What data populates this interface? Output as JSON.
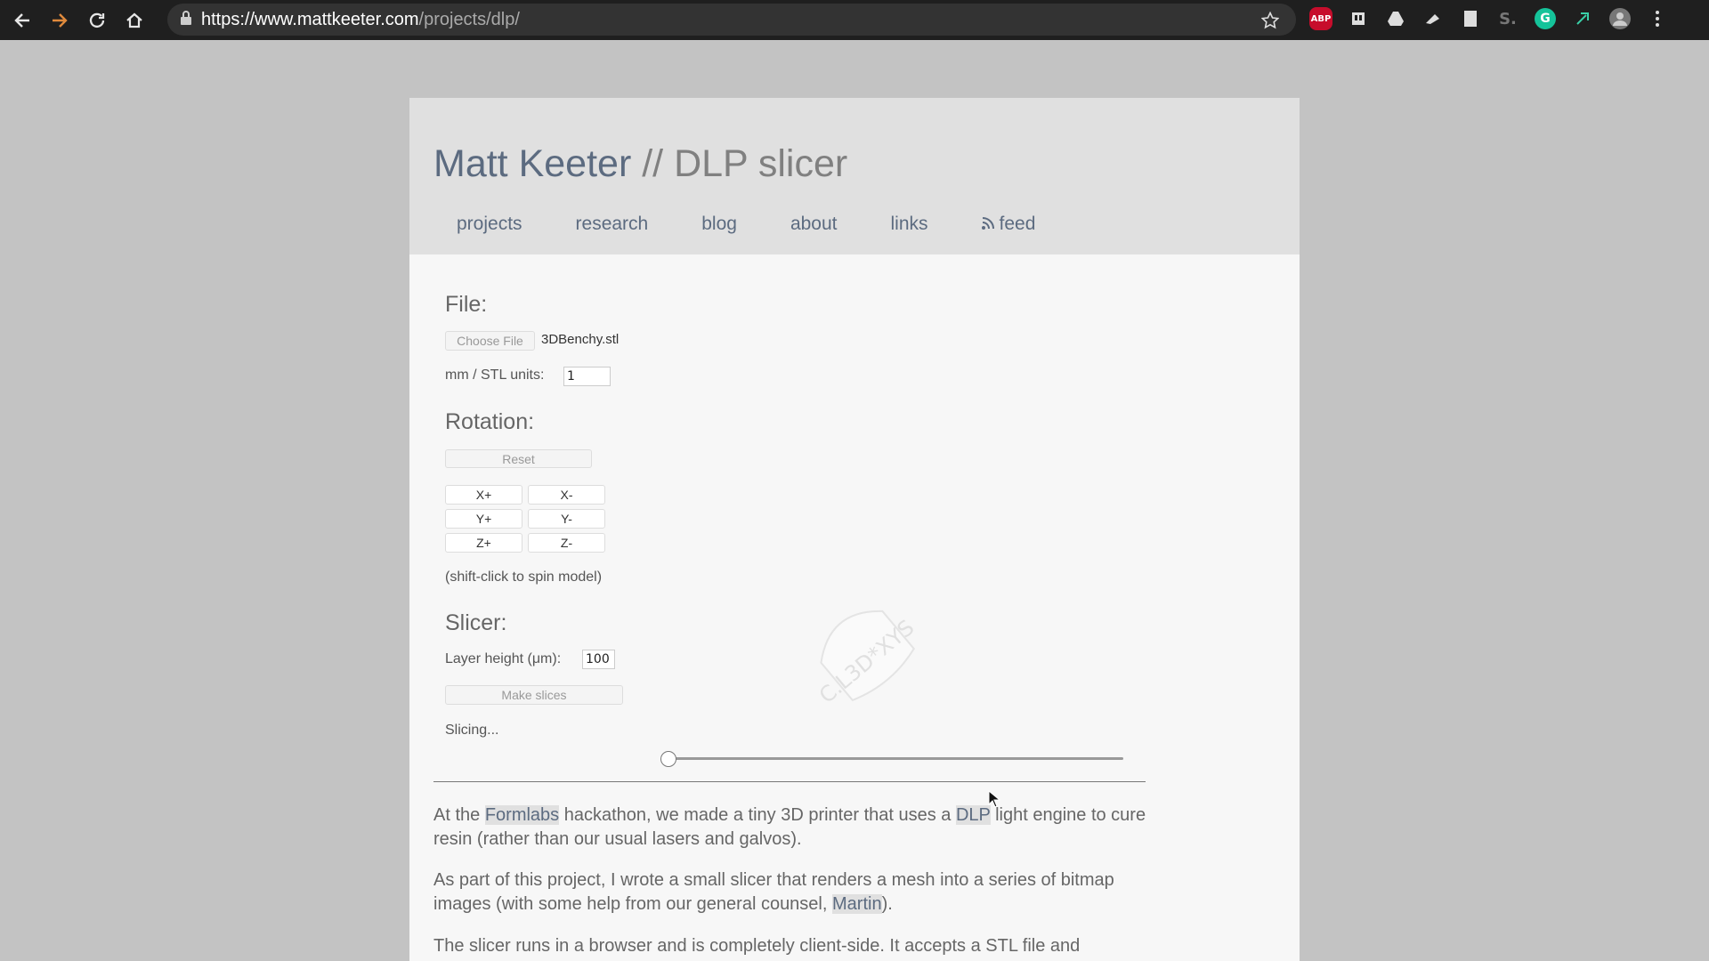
{
  "browser": {
    "url_host": "https://www.mattkeeter.com",
    "url_path": "/projects/dlp/",
    "extensions": [
      "adblock-icon",
      "reader-icon",
      "drive-icon",
      "ink-icon",
      "document-icon",
      "s-icon",
      "grammarly-icon",
      "puzzle-icon",
      "avatar-icon",
      "menu-icon"
    ],
    "abp_label": "ABP",
    "grammarly_label": "G",
    "s_label": "S."
  },
  "header": {
    "name": "Matt Keeter",
    "separator": " // ",
    "page": "DLP slicer",
    "nav": [
      "projects",
      "research",
      "blog",
      "about",
      "links",
      "feed"
    ]
  },
  "file": {
    "heading": "File:",
    "choose_label": "Choose File",
    "filename": "3DBenchy.stl",
    "units_label": "mm / STL units:",
    "units_value": "1"
  },
  "rotation": {
    "heading": "Rotation:",
    "reset_label": "Reset",
    "buttons": [
      "X+",
      "X-",
      "Y+",
      "Y-",
      "Z+",
      "Z-"
    ],
    "hint": "(shift-click to spin model)"
  },
  "slicer": {
    "heading": "Slicer:",
    "layer_label": "Layer height (μm):",
    "layer_value": "100",
    "make_label": "Make slices",
    "status": "Slicing...",
    "slider_position": 0
  },
  "model": {
    "label": "C.L3D*XYS"
  },
  "article": {
    "p1_a": "At the ",
    "p1_link1": "Formlabs",
    "p1_b": " hackathon, we made a tiny 3D printer that uses a ",
    "p1_link2": "DLP",
    "p1_c": " light engine to cure resin (rather than our usual lasers and galvos).",
    "p2_a": "As part of this project, I wrote a small slicer that renders a mesh into a series of bitmap images (with some help from our general counsel, ",
    "p2_link": "Martin",
    "p2_b": ").",
    "p3": "The slicer runs in a browser and is completely client-side. It accepts a STL file and"
  }
}
